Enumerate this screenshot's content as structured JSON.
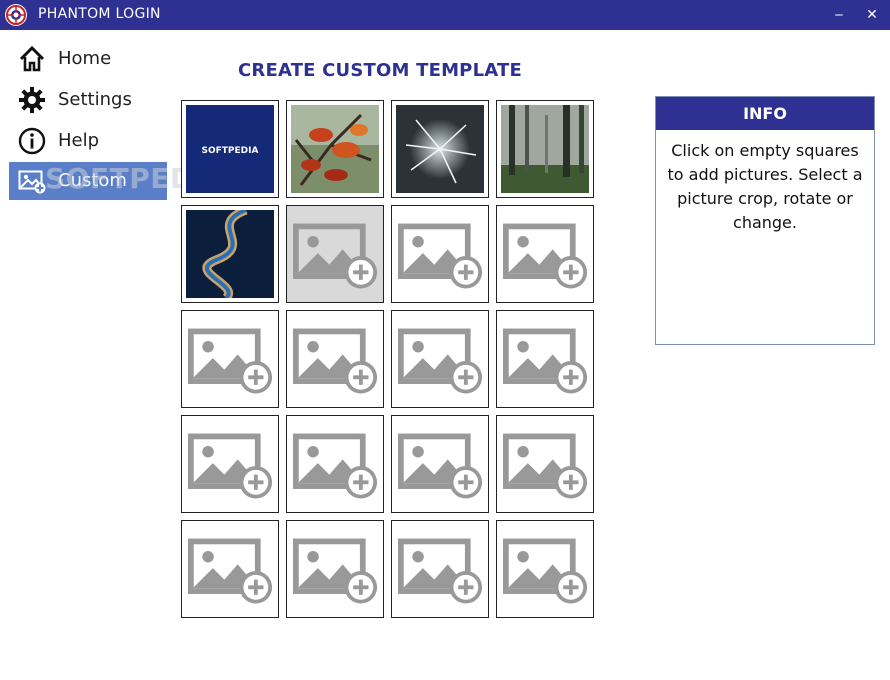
{
  "window": {
    "title": "PHANTOM LOGIN",
    "minimize": "‒",
    "close": "✕"
  },
  "sidebar": {
    "items": [
      {
        "label": "Home",
        "icon": "home-icon"
      },
      {
        "label": "Settings",
        "icon": "gear-icon"
      },
      {
        "label": "Help",
        "icon": "info-icon"
      },
      {
        "label": "Custom",
        "icon": "add-image-icon",
        "active": true
      }
    ]
  },
  "watermark": "SOFTPEDIA",
  "main": {
    "title": "CREATE CUSTOM TEMPLATE",
    "tiles": [
      {
        "type": "image",
        "name": "softpedia-logo-picture",
        "text": "SOFTPEDIA"
      },
      {
        "type": "image",
        "name": "autumn-leaves-picture"
      },
      {
        "type": "image",
        "name": "frosted-branch-picture"
      },
      {
        "type": "image",
        "name": "misty-forest-picture"
      },
      {
        "type": "image",
        "name": "river-aerial-picture"
      },
      {
        "type": "empty",
        "hover": true
      },
      {
        "type": "empty"
      },
      {
        "type": "empty"
      },
      {
        "type": "empty"
      },
      {
        "type": "empty"
      },
      {
        "type": "empty"
      },
      {
        "type": "empty"
      },
      {
        "type": "empty"
      },
      {
        "type": "empty"
      },
      {
        "type": "empty"
      },
      {
        "type": "empty"
      },
      {
        "type": "empty"
      },
      {
        "type": "empty"
      },
      {
        "type": "empty"
      },
      {
        "type": "empty"
      }
    ]
  },
  "info": {
    "title": "INFO",
    "text": "Click on empty squares to add pictures. Select a picture crop, rotate or change."
  },
  "colors": {
    "brand": "#2e3192",
    "active_nav": "#5a7fc8",
    "placeholder": "#999999"
  }
}
